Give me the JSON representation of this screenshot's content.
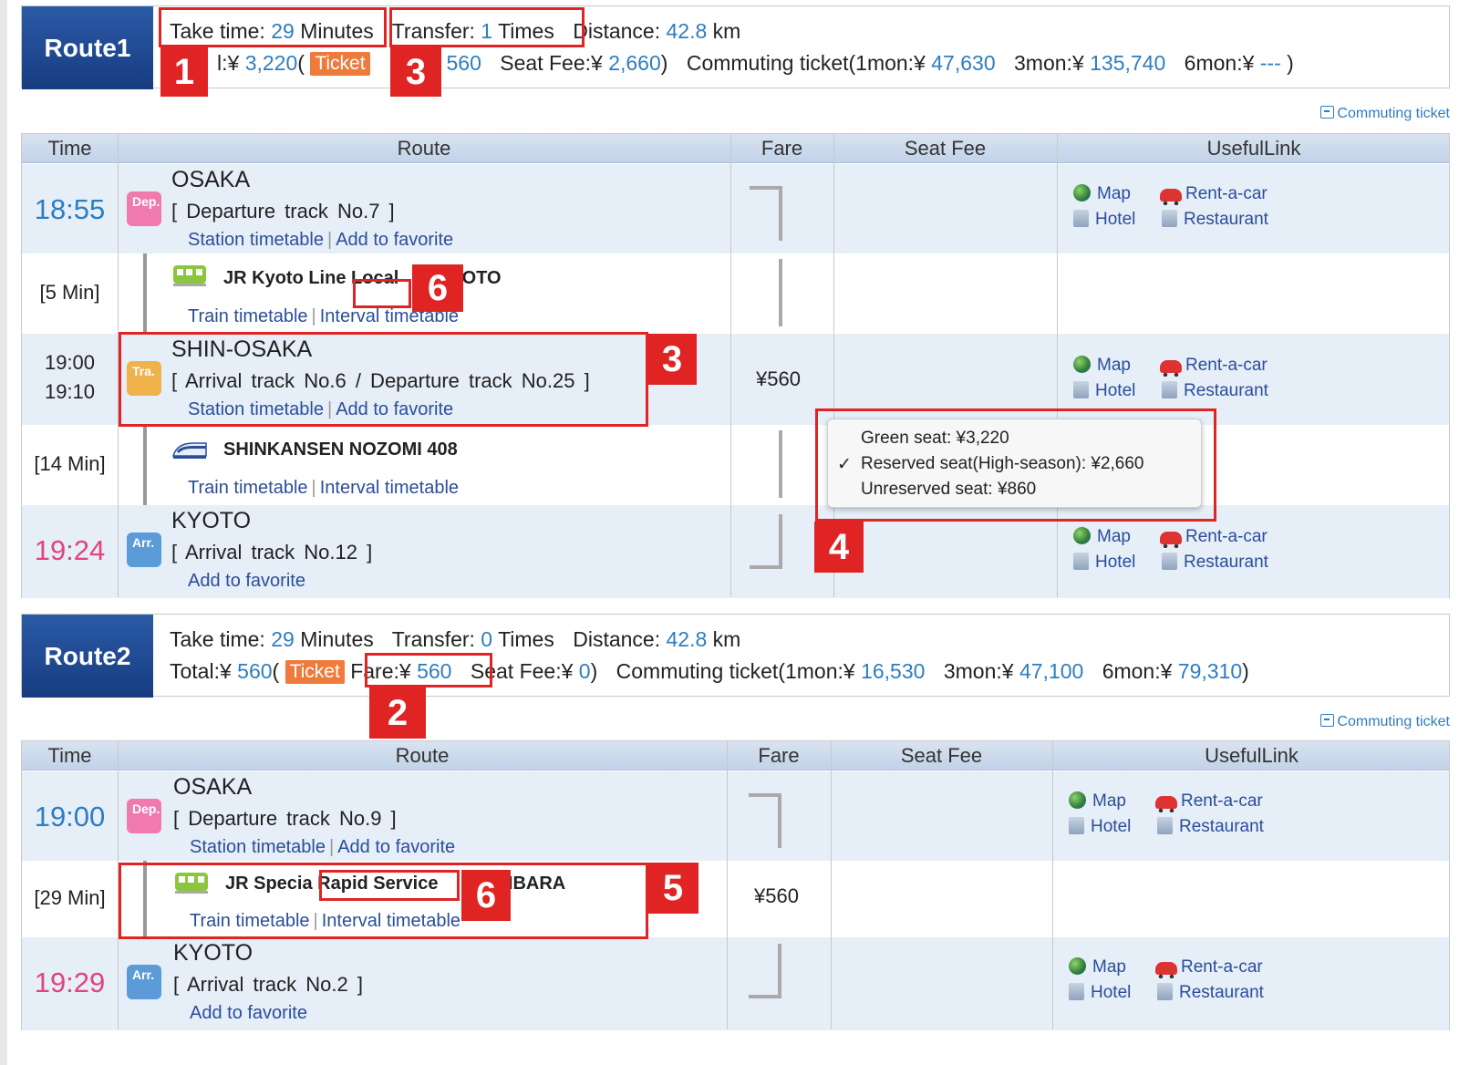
{
  "route1": {
    "badge": "Route1",
    "take_time_label": "Take time:",
    "take_time_value": "29",
    "take_time_unit": "Minutes",
    "transfer_label": "Transfer:",
    "transfer_value": "1",
    "transfer_unit": "Times",
    "distance_label": "Distance:",
    "distance_value": "42.8",
    "distance_unit": "km",
    "total_label": "l:¥",
    "total_value": "3,220",
    "open_paren": "(",
    "ticket_label": "Ticket",
    "fare_value": "¥ 560",
    "seat_fee_label": "Seat Fee:¥",
    "seat_fee_value": "2,660",
    "close_paren": ")",
    "commute_label": "Commuting ticket(1mon:¥",
    "mon1_value": "47,630",
    "mon3_label": "3mon:¥",
    "mon3_value": "135,740",
    "mon6_label": "6mon:¥",
    "mon6_value": "---",
    "commute_close": ")",
    "commute_link": "Commuting ticket",
    "headers": {
      "time": "Time",
      "route": "Route",
      "fare": "Fare",
      "seat_fee": "Seat Fee",
      "useful": "UsefulLink"
    },
    "stations": [
      {
        "time": "18:55",
        "icon": "Dep.",
        "name": "OSAKA",
        "track": "[ Departure track No.7 ]",
        "link1": "Station timetable",
        "link2": "Add to favorite"
      },
      {
        "time_arr": "19:00",
        "time_dep": "19:10",
        "icon": "Tra.",
        "name": "SHIN-OSAKA",
        "track": "[ Arrival track No.6 / Departure track No.25 ]",
        "link1": "Station timetable",
        "link2": "Add to favorite"
      },
      {
        "time": "19:24",
        "icon": "Arr.",
        "name": "KYOTO",
        "track": "[ Arrival track No.12 ]",
        "link2": "Add to favorite"
      }
    ],
    "segments": [
      {
        "duration": "[5 Min]",
        "line_a": "JR Kyoto Line",
        "line_b": "Local",
        "line_c": "YOTO",
        "link1": "Train timetable",
        "link2": "Interval timetable"
      },
      {
        "duration": "[14 Min]",
        "line_a": "SHINKANSEN NOZOMI 408",
        "link1": "Train timetable",
        "link2": "Interval timetable"
      }
    ],
    "fare_cell": "¥560",
    "seat_popup": {
      "opt1": "Green seat: ¥3,220",
      "opt2": "Reserved seat(High-season): ¥2,660",
      "opt3": "Unreserved seat: ¥860",
      "check": "✓"
    }
  },
  "route2": {
    "badge": "Route2",
    "take_time_label": "Take time:",
    "take_time_value": "29",
    "take_time_unit": "Minutes",
    "transfer_label": "Transfer:",
    "transfer_value": "0",
    "transfer_unit": "Times",
    "distance_label": "Distance:",
    "distance_value": "42.8",
    "distance_unit": "km",
    "total_label": "Total:¥",
    "total_value": "560",
    "open_paren": "(",
    "ticket_label": "Ticket",
    "fare_label": "Fare:¥",
    "fare_value": "560",
    "seat_fee_label": "Seat Fee:¥",
    "seat_fee_value": "0",
    "close_paren": ")",
    "commute_label": "Commuting ticket(1mon:¥",
    "mon1_value": "16,530",
    "mon3_label": "3mon:¥",
    "mon3_value": "47,100",
    "mon6_label": "6mon:¥",
    "mon6_value": "79,310",
    "commute_close": ")",
    "commute_link": "Commuting ticket",
    "headers": {
      "time": "Time",
      "route": "Route",
      "fare": "Fare",
      "seat_fee": "Seat Fee",
      "useful": "UsefulLink"
    },
    "stations": [
      {
        "time": "19:00",
        "icon": "Dep.",
        "name": "OSAKA",
        "track": "[ Departure track No.9 ]",
        "link1": "Station timetable",
        "link2": "Add to favorite"
      },
      {
        "time": "19:29",
        "icon": "Arr.",
        "name": "KYOTO",
        "track": "[ Arrival track No.2 ]",
        "link2": "Add to favorite"
      }
    ],
    "segments": [
      {
        "duration": "[29 Min]",
        "line_a": "JR Specia",
        "line_b": "Rapid Service",
        "line_c": "AIBARA",
        "link1": "Train timetable",
        "link2": "Interval timetable"
      }
    ],
    "fare_cell": "¥560"
  },
  "useful_links": {
    "map": "Map",
    "rent": "Rent-a-car",
    "hotel": "Hotel",
    "restaurant": "Restaurant"
  },
  "links_sep": "|",
  "annotations": [
    "1",
    "2",
    "3",
    "3",
    "4",
    "5",
    "6",
    "6"
  ],
  "colors": {
    "accent_blue": "#2e7dc0",
    "arrival_pink": "#e0457b",
    "ticket_orange": "#ee7a3b",
    "annotation_red": "#e02424",
    "route_badge": "#1e4890"
  }
}
